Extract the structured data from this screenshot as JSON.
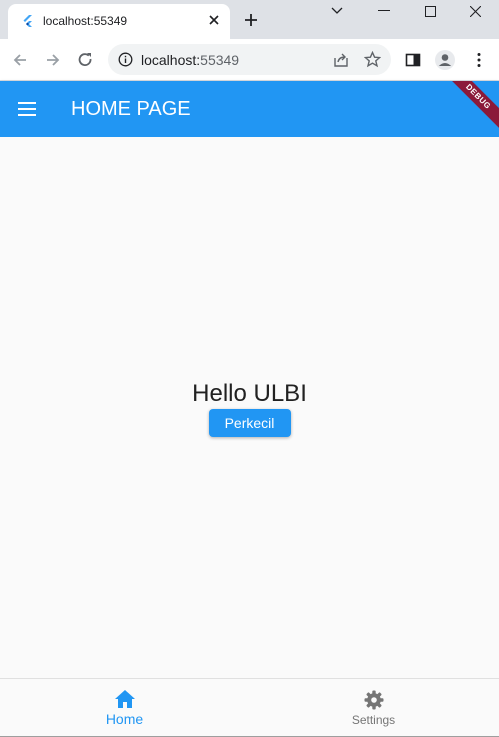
{
  "browser": {
    "tab_title": "localhost:55349",
    "url_host": "localhost:",
    "url_port": "55349"
  },
  "app": {
    "title": "HOME PAGE",
    "debug_banner": "DEBUG",
    "primary_color": "#2196f3"
  },
  "main": {
    "greeting": "Hello ULBI",
    "shrink_button_label": "Perkecil"
  },
  "bottom_nav": {
    "items": [
      {
        "label": "Home",
        "icon": "home-icon",
        "active": true
      },
      {
        "label": "Settings",
        "icon": "settings-icon",
        "active": false
      }
    ]
  }
}
